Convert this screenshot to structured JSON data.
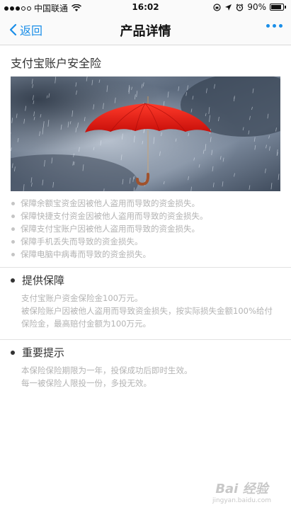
{
  "status_bar": {
    "carrier": "中国联通",
    "time": "16:02",
    "battery_percent": "90%",
    "battery_level": 0.9,
    "icons": [
      "signal-dots",
      "wifi-icon",
      "lock-rotation-icon",
      "location-arrow-icon",
      "alarm-icon",
      "battery-icon"
    ]
  },
  "nav": {
    "back_label": "返回",
    "title": "产品详情",
    "more_icon": "more-dots-icon",
    "accent_color": "#1a8ee8"
  },
  "product": {
    "name": "支付宝账户安全险",
    "hero_image": "red-umbrella-in-rain"
  },
  "features": [
    "保障余额宝资金因被他人盗用而导致的资金损失。",
    "保障快捷支付资金因被他人盗用而导致的资金损失。",
    "保障支付宝账户因被他人盗用而导致的资金损失。",
    "保障手机丢失而导致的资金损失。",
    "保障电脑中病毒而导致的资金损失。"
  ],
  "coverage": {
    "title": "提供保障",
    "lines": [
      "支付宝账户资金保险金100万元。",
      "被保险账户因被他人盗用而导致资金损失，按实际损失金额100%给付保险金，最高赔付金额为100万元。"
    ]
  },
  "notice": {
    "title": "重要提示",
    "lines": [
      "本保险保险期限为一年，投保成功后即时生效。",
      "每一被保险人限投一份，多投无效。"
    ]
  },
  "watermark": {
    "main": "Bai 经验",
    "sub": "jingyan.baidu.com"
  }
}
